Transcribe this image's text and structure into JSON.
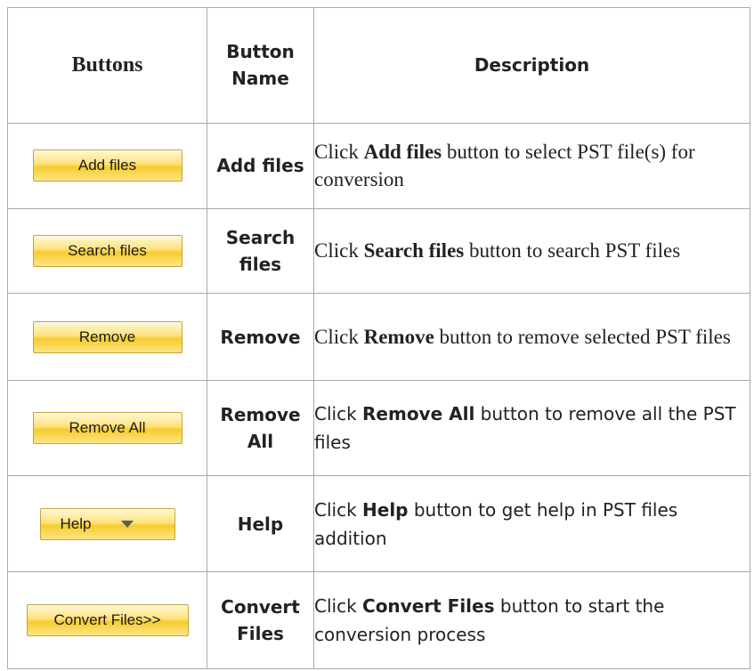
{
  "header": {
    "col_buttons": "Buttons",
    "col_name": "Button Name",
    "col_description": "Description"
  },
  "rows": [
    {
      "button_label": "Add files",
      "name": "Add files",
      "desc_pre": "Click ",
      "desc_bold": "Add files",
      "desc_post": "  button to select PST file(s) for conversion"
    },
    {
      "button_label": "Search files",
      "name": "Search files",
      "desc_pre": " Click ",
      "desc_bold": "Search files",
      "desc_post": " button to search PST files"
    },
    {
      "button_label": "Remove",
      "name": "Remove",
      "desc_pre": " Click ",
      "desc_bold": "Remove",
      "desc_post": " button to remove selected PST files"
    },
    {
      "button_label": "Remove All",
      "name": "Remove All",
      "desc_pre": " Click  ",
      "desc_bold": "Remove All",
      "desc_post": " button to remove all the PST files"
    },
    {
      "button_label": "Help",
      "button_icon": "chevron-down-icon",
      "name": "Help",
      "desc_pre": " Click ",
      "desc_bold": "Help",
      "desc_post": " button to get help in PST files addition"
    },
    {
      "button_label": "Convert Files>>",
      "name": "Convert Files",
      "desc_pre": " Click  ",
      "desc_bold": "Convert Files",
      "desc_post": " button to start the conversion process"
    }
  ],
  "colors": {
    "button_fill": "#fde27a",
    "button_border": "#c9a23a",
    "table_border": "#aaaaaa"
  }
}
